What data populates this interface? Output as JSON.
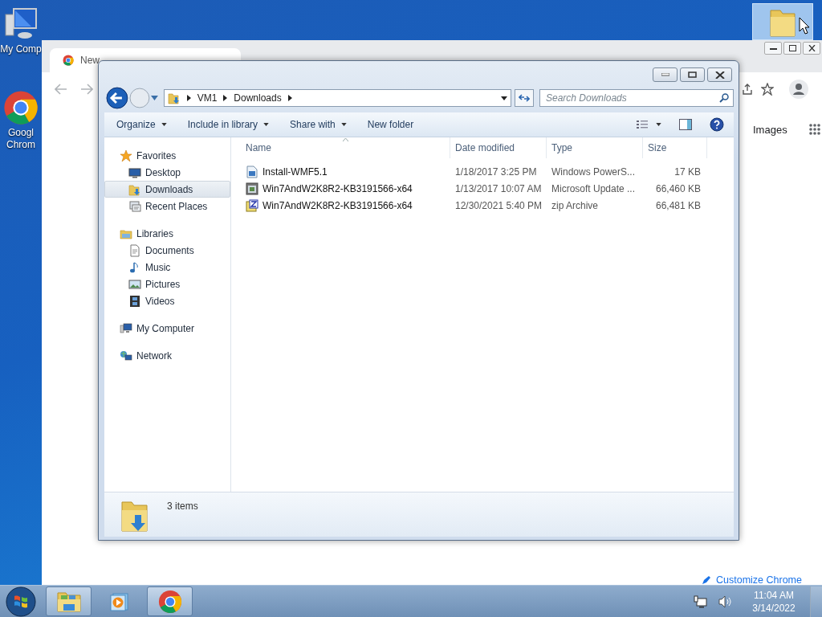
{
  "desktop": {
    "icons": [
      {
        "label": "My Comp",
        "kind": "computer"
      },
      {
        "label": "Googl Chrom",
        "kind": "chrome"
      }
    ],
    "dragged_folder": {
      "selected": true
    }
  },
  "browser": {
    "tab": {
      "title": "New"
    },
    "link": "Images",
    "customize": "Customize Chrome"
  },
  "explorer": {
    "breadcrumb": [
      "VM1",
      "Downloads"
    ],
    "search": {
      "placeholder": "Search Downloads"
    },
    "toolbar": [
      {
        "label": "Organize",
        "menu": true
      },
      {
        "label": "Include in library",
        "menu": true
      },
      {
        "label": "Share with",
        "menu": true
      },
      {
        "label": "New folder",
        "menu": false
      }
    ],
    "nav": [
      {
        "label": "Favorites",
        "kind": "star",
        "selected": false,
        "children": [
          {
            "label": "Desktop",
            "kind": "desktop",
            "selected": false
          },
          {
            "label": "Downloads",
            "kind": "downloads",
            "selected": true
          },
          {
            "label": "Recent Places",
            "kind": "recent",
            "selected": false
          }
        ]
      },
      {
        "label": "Libraries",
        "kind": "libraries",
        "selected": false,
        "children": [
          {
            "label": "Documents",
            "kind": "document",
            "selected": false
          },
          {
            "label": "Music",
            "kind": "music",
            "selected": false
          },
          {
            "label": "Pictures",
            "kind": "pictures",
            "selected": false
          },
          {
            "label": "Videos",
            "kind": "videos",
            "selected": false
          }
        ]
      },
      {
        "label": "My Computer",
        "kind": "computer",
        "selected": false
      },
      {
        "label": "Network",
        "kind": "network",
        "selected": false
      }
    ],
    "columns": [
      "Name",
      "Date modified",
      "Type",
      "Size"
    ],
    "files": [
      {
        "name": "Install-WMF5.1",
        "kind": "script",
        "date": "1/18/2017 3:25 PM",
        "type": "Windows PowerS...",
        "size": "17 KB"
      },
      {
        "name": "Win7AndW2K8R2-KB3191566-x64",
        "kind": "update",
        "date": "1/13/2017 10:07 AM",
        "type": "Microsoft Update ...",
        "size": "66,460 KB"
      },
      {
        "name": "Win7AndW2K8R2-KB3191566-x64",
        "kind": "zip",
        "date": "12/30/2021 5:40 PM",
        "type": "zip Archive",
        "size": "66,481 KB"
      }
    ],
    "status": "3 items"
  },
  "taskbar": {
    "apps": [
      {
        "kind": "explorer",
        "active": true
      },
      {
        "kind": "media",
        "active": false
      },
      {
        "kind": "chrome",
        "active": true
      }
    ],
    "time": "11:04 AM",
    "date": "3/14/2022"
  }
}
